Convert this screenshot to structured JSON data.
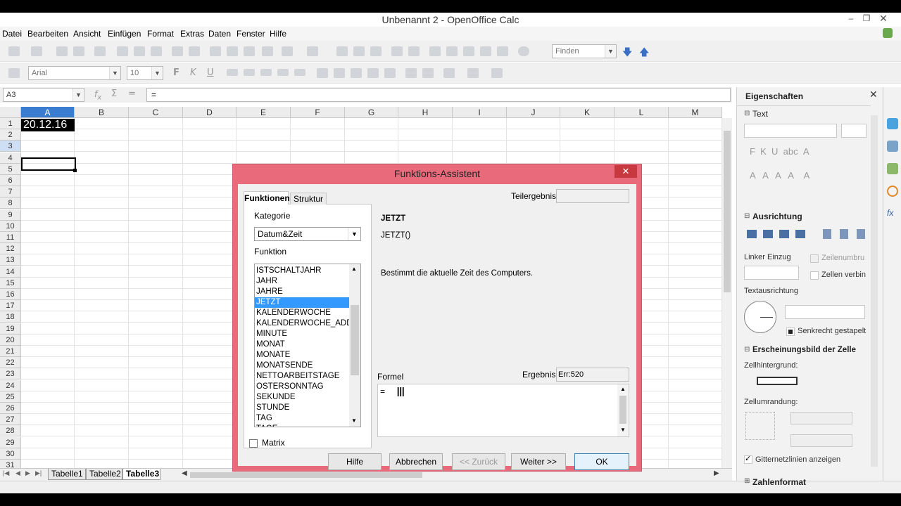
{
  "window": {
    "title": "Unbenannt 2 - OpenOffice Calc"
  },
  "menu": [
    "Datei",
    "Bearbeiten",
    "Ansicht",
    "Einfügen",
    "Format",
    "Extras",
    "Daten",
    "Fenster",
    "Hilfe"
  ],
  "toolbar": {
    "find_placeholder": "Finden"
  },
  "format_toolbar": {
    "font_name": "Arial",
    "font_size": "10"
  },
  "formula_bar": {
    "cell_ref": "A3",
    "content": "="
  },
  "sheet": {
    "columns": [
      "A",
      "B",
      "C",
      "D",
      "E",
      "F",
      "G",
      "H",
      "I",
      "J",
      "K",
      "L",
      "M"
    ],
    "rows": [
      "1",
      "2",
      "3",
      "4",
      "5",
      "6",
      "7",
      "8",
      "9",
      "10",
      "11",
      "12",
      "13",
      "14",
      "15",
      "16",
      "17",
      "18",
      "19",
      "20",
      "21",
      "22",
      "23",
      "24",
      "25",
      "26",
      "27",
      "28",
      "29",
      "30",
      "31"
    ],
    "cell_a1": "20.12.16",
    "tabs": [
      "Tabelle1",
      "Tabelle2",
      "Tabelle3"
    ],
    "active_tab": "Tabelle3"
  },
  "sidebar": {
    "title": "Eigenschaften",
    "section_text": "Text",
    "section_align": "Ausrichtung",
    "indent_label": "Linker Einzug",
    "wrap_label": "Zeilenumbru",
    "merge_label": "Zellen verbin",
    "orientation_label": "Textausrichtung",
    "stacked_label": "Senkrecht gestapelt",
    "section_appearance": "Erscheinungsbild der Zelle",
    "bg_label": "Zellhintergrund:",
    "border_label": "Zellumrandung:",
    "grid_label": "Gitternetzlinien anzeigen",
    "section_number": "Zahlenformat"
  },
  "dialog": {
    "title": "Funktions-Assistent",
    "tab_functions": "Funktionen",
    "tab_structure": "Struktur",
    "category_label": "Kategorie",
    "category_value": "Datum&Zeit",
    "function_label": "Funktion",
    "functions": [
      "ISTSCHALTJAHR",
      "JAHR",
      "JAHRE",
      "JETZT",
      "KALENDERWOCHE",
      "KALENDERWOCHE_ADD",
      "MINUTE",
      "MONAT",
      "MONATE",
      "MONATSENDE",
      "NETTOARBEITSTAGE",
      "OSTERSONNTAG",
      "SEKUNDE",
      "STUNDE",
      "TAG",
      "TAGE"
    ],
    "selected_function": "JETZT",
    "subtotal_label": "Teilergebnis",
    "func_name": "JETZT",
    "func_signature": "JETZT()",
    "func_description": "Bestimmt die aktuelle Zeit des Computers.",
    "formula_label": "Formel",
    "result_label": "Ergebnis",
    "result_value": "Err:520",
    "formula_value": "=",
    "matrix_label": "Matrix",
    "buttons": {
      "help": "Hilfe",
      "cancel": "Abbrechen",
      "back": "<< Zurück",
      "next": "Weiter >>",
      "ok": "OK"
    }
  },
  "colors": {
    "selection": "#3399ff",
    "dialog_frame": "#e86a7b",
    "close_button": "#c7383f",
    "cell_a1_bg": "#000000",
    "cell_a1_text": "#ffffff"
  }
}
